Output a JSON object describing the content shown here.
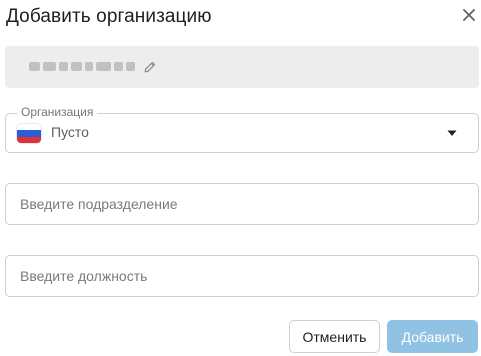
{
  "dialog": {
    "title": "Добавить организацию",
    "close_icon": "close-icon"
  },
  "user": {
    "name": "",
    "edit_icon": "pencil-icon"
  },
  "organization": {
    "legend": "Организация",
    "value": "Пусто",
    "flag_icon": "russia-flag-icon",
    "flag_colors": [
      "#ffffff",
      "#2a5ed8",
      "#e0303a"
    ],
    "dropdown_icon": "caret-down-icon"
  },
  "subdivision": {
    "placeholder": "Введите подразделение",
    "value": ""
  },
  "position": {
    "placeholder": "Введите должность",
    "value": ""
  },
  "actions": {
    "cancel_label": "Отменить",
    "add_label": "Добавить"
  },
  "colors": {
    "primary_disabled": "#90c3e3",
    "field_border": "#cfcfcf",
    "user_box_bg": "#ededed"
  }
}
